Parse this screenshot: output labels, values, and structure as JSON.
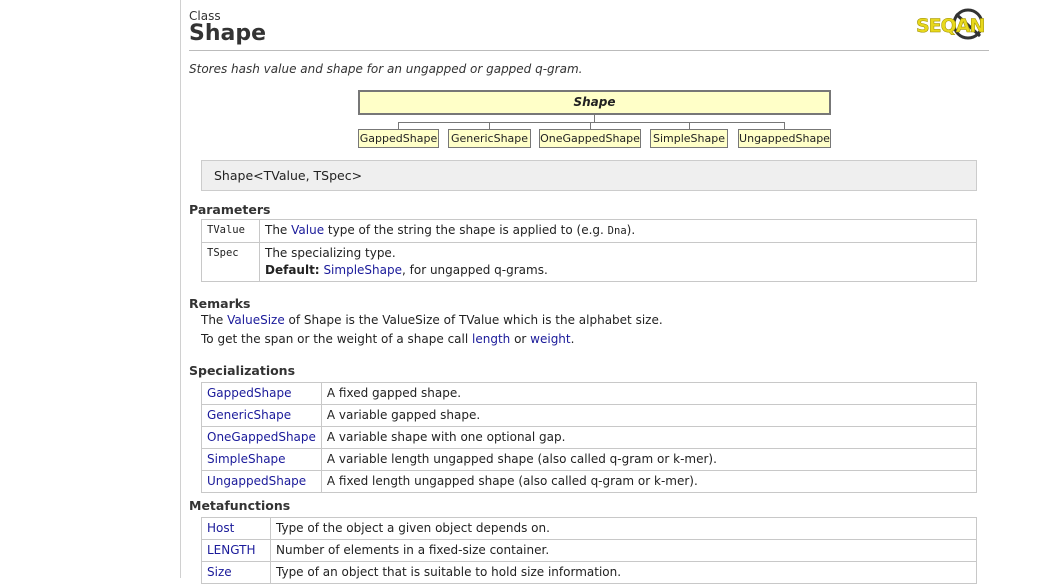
{
  "header": {
    "kind": "Class",
    "title": "Shape",
    "logo_text": "SEQAN"
  },
  "summary": "Stores hash value and shape for an ungapped or gapped q-gram.",
  "diagram": {
    "parent": "Shape",
    "children": [
      "GappedShape",
      "GenericShape",
      "OneGappedShape",
      "SimpleShape",
      "UngappedShape"
    ]
  },
  "signature": "Shape<TValue, TSpec>",
  "parameters": {
    "heading": "Parameters",
    "tvalue": {
      "name": "TValue",
      "pre": "The ",
      "link": "Value",
      "mid": " type of the string the shape is applied to (e.g. ",
      "code": "Dna",
      "post": ")."
    },
    "tspec": {
      "name": "TSpec",
      "line1": "The specializing type.",
      "default_label": "Default:",
      "default_link": "SimpleShape",
      "default_post": ", for ungapped q-grams."
    }
  },
  "remarks": {
    "heading": "Remarks",
    "l1_pre": "The ",
    "l1_link": "ValueSize",
    "l1_post": " of Shape is the ValueSize of TValue which is the alphabet size.",
    "l2_pre": "To get the span or the weight of a shape call ",
    "l2_link1": "length",
    "l2_mid": " or ",
    "l2_link2": "weight",
    "l2_post": "."
  },
  "specializations": {
    "heading": "Specializations",
    "rows": [
      {
        "name": "GappedShape",
        "desc": "A fixed gapped shape."
      },
      {
        "name": "GenericShape",
        "desc": "A variable gapped shape."
      },
      {
        "name": "OneGappedShape",
        "desc": "A variable shape with one optional gap."
      },
      {
        "name": "SimpleShape",
        "desc": "A variable length ungapped shape (also called q-gram or k-mer)."
      },
      {
        "name": "UngappedShape",
        "desc": "A fixed length ungapped shape (also called q-gram or k-mer)."
      }
    ]
  },
  "metafunctions": {
    "heading": "Metafunctions",
    "rows": [
      {
        "name": "Host",
        "desc": "Type of the object a given object depends on."
      },
      {
        "name": "LENGTH",
        "desc": "Number of elements in a fixed-size container."
      },
      {
        "name": "Size",
        "desc": "Type of an object that is suitable to hold size information."
      }
    ]
  }
}
